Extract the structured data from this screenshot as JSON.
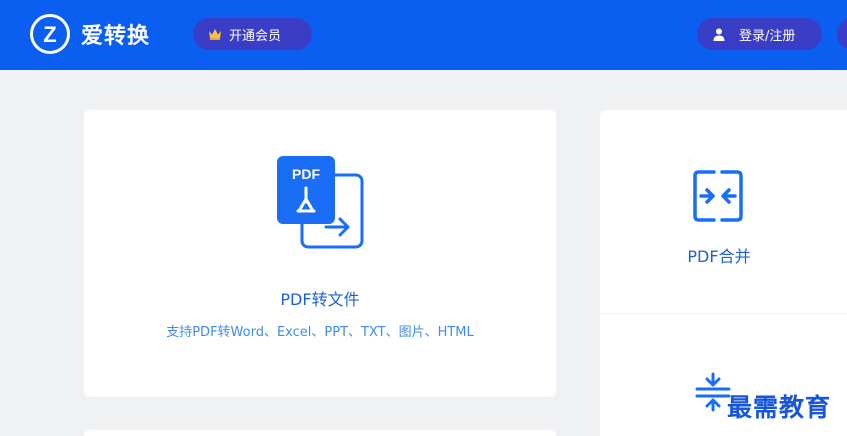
{
  "header": {
    "brand_logo_letter": "Z",
    "brand_name": "爱转换",
    "vip_label": "开通会员",
    "login_label": "登录/注册"
  },
  "main_card": {
    "icon_text": "PDF",
    "title": "PDF转文件",
    "description": "支持PDF转Word、Excel、PPT、TXT、图片、HTML"
  },
  "side_cards": {
    "merge_title": "PDF合并"
  },
  "watermark": "最需教育",
  "colors": {
    "header_bg": "#0a5ff0",
    "pill_bg": "#3a3ec7",
    "title_blue": "#1f5fd9",
    "desc_blue": "#3d8bf2",
    "icon_blue": "#1a6ef5",
    "page_bg": "#f0f1f3"
  },
  "icons": {
    "brand": "z-logo-icon",
    "vip": "crown-icon",
    "login": "user-icon",
    "main": "pdf-convert-icon",
    "merge": "pdf-merge-icon",
    "compress": "pdf-compress-icon"
  }
}
